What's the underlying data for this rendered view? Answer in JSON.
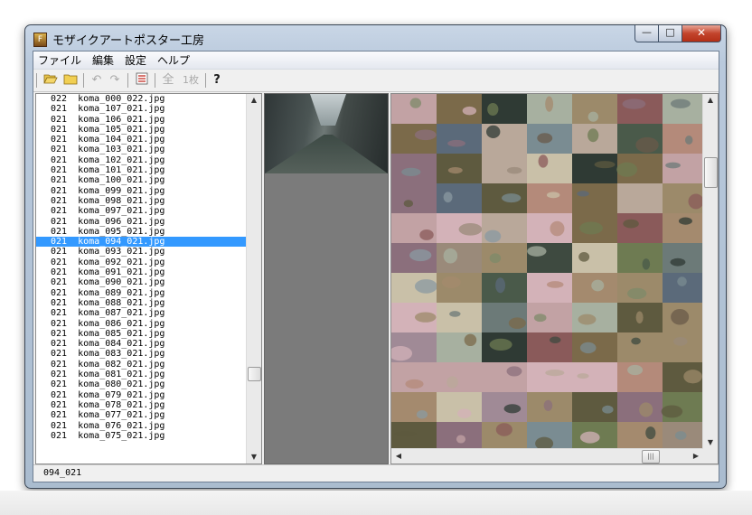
{
  "window": {
    "title": "モザイクアートポスター工房",
    "icon": "app-icon",
    "controls": {
      "minimize": "—",
      "maximize": "□",
      "close": "✕"
    }
  },
  "menu": [
    "ファイル",
    "編集",
    "設定",
    "ヘルプ"
  ],
  "toolbar": {
    "icons": [
      "folder-open-icon",
      "folder-icon",
      "undo-icon",
      "redo-icon",
      "list-icon",
      "all-icon",
      "one-sheet-icon",
      "help-icon"
    ],
    "all_label": "全",
    "one_label": "1枚",
    "help_label": "?"
  },
  "file_list": {
    "selected_index": 15,
    "rows": [
      {
        "num": "022",
        "name": "koma_000_022.jpg"
      },
      {
        "num": "021",
        "name": "koma_107_021.jpg"
      },
      {
        "num": "021",
        "name": "koma_106_021.jpg"
      },
      {
        "num": "021",
        "name": "koma_105_021.jpg"
      },
      {
        "num": "021",
        "name": "koma_104_021.jpg"
      },
      {
        "num": "021",
        "name": "koma_103_021.jpg"
      },
      {
        "num": "021",
        "name": "koma_102_021.jpg"
      },
      {
        "num": "021",
        "name": "koma_101_021.jpg"
      },
      {
        "num": "021",
        "name": "koma_100_021.jpg"
      },
      {
        "num": "021",
        "name": "koma_099_021.jpg"
      },
      {
        "num": "021",
        "name": "koma_098_021.jpg"
      },
      {
        "num": "021",
        "name": "koma_097_021.jpg"
      },
      {
        "num": "021",
        "name": "koma_096_021.jpg"
      },
      {
        "num": "021",
        "name": "koma_095_021.jpg"
      },
      {
        "num": "021",
        "name": "koma_094_021.jpg"
      },
      {
        "num": "021",
        "name": "koma_093_021.jpg"
      },
      {
        "num": "021",
        "name": "koma_092_021.jpg"
      },
      {
        "num": "021",
        "name": "koma_091_021.jpg"
      },
      {
        "num": "021",
        "name": "koma_090_021.jpg"
      },
      {
        "num": "021",
        "name": "koma_089_021.jpg"
      },
      {
        "num": "021",
        "name": "koma_088_021.jpg"
      },
      {
        "num": "021",
        "name": "koma_087_021.jpg"
      },
      {
        "num": "021",
        "name": "koma_086_021.jpg"
      },
      {
        "num": "021",
        "name": "koma_085_021.jpg"
      },
      {
        "num": "021",
        "name": "koma_084_021.jpg"
      },
      {
        "num": "021",
        "name": "koma_083_021.jpg"
      },
      {
        "num": "021",
        "name": "koma_082_021.jpg"
      },
      {
        "num": "021",
        "name": "koma_081_021.jpg"
      },
      {
        "num": "021",
        "name": "koma_080_021.jpg"
      },
      {
        "num": "021",
        "name": "koma_079_021.jpg"
      },
      {
        "num": "021",
        "name": "koma_078_021.jpg"
      },
      {
        "num": "021",
        "name": "koma_077_021.jpg"
      },
      {
        "num": "021",
        "name": "koma_076_021.jpg"
      },
      {
        "num": "021",
        "name": "koma_075_021.jpg"
      }
    ]
  },
  "status": {
    "text": "094_021"
  },
  "mosaic": {
    "palette": [
      "#5e5a3f",
      "#7b6a4a",
      "#9c8a6a",
      "#6e7b52",
      "#a08a96",
      "#8b6f7c",
      "#4a5a4a",
      "#3e4a40",
      "#6c7a78",
      "#8a9aa2",
      "#b9a89a",
      "#c2a2a4",
      "#7d8a6a",
      "#a7b0a0",
      "#5b6a7a",
      "#2f3a34",
      "#8a5a5a",
      "#b48a7a",
      "#d3b2b8",
      "#9a8a7a",
      "#6a5a4a",
      "#c9c0a8",
      "#7a8c92",
      "#a48a6e"
    ]
  },
  "colors": {
    "selection": "#3399ff",
    "window_border": "#3a4656"
  }
}
